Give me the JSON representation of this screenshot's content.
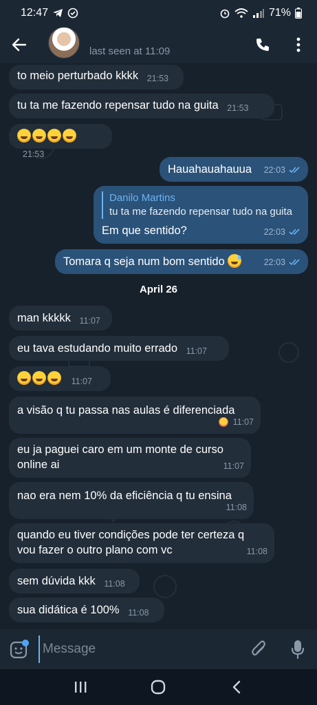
{
  "status_bar": {
    "time": "12:47",
    "battery": "71%"
  },
  "header": {
    "last_seen": "last seen at 11:09"
  },
  "messages": [
    {
      "dir": "in",
      "text": "to meio perturbado kkkk",
      "time": "21:53"
    },
    {
      "dir": "in",
      "text": "tu ta me fazendo repensar tudo na guita",
      "time": "21:53"
    },
    {
      "dir": "in",
      "text": "",
      "time": "21:53"
    },
    {
      "dir": "out",
      "text": "Hauahauahauua",
      "time": "22:03"
    },
    {
      "dir": "out",
      "quote_name": "Danilo Martins",
      "quote_text": "tu ta me fazendo repensar tudo na guita",
      "text": "Em que sentido?",
      "time": "22:03"
    },
    {
      "dir": "out",
      "text": "Tomara q seja num bom sentido",
      "time": "22:03"
    },
    {
      "dir": "date",
      "text": "April 26"
    },
    {
      "dir": "in",
      "text": "man kkkkk",
      "time": "11:07"
    },
    {
      "dir": "in",
      "text": "eu tava estudando muito errado",
      "time": "11:07"
    },
    {
      "dir": "in",
      "text": "",
      "time": "11:07"
    },
    {
      "dir": "in",
      "text": "a visão q tu passa nas aulas é diferenciada",
      "time": "11:07"
    },
    {
      "dir": "in",
      "text_line1": "eu ja paguei caro em um monte de curso",
      "text_line2": "online ai",
      "time": "11:07"
    },
    {
      "dir": "in",
      "text": "nao era nem 10% da eficiência q tu ensina",
      "time": "11:08"
    },
    {
      "dir": "in",
      "text_line1": "quando eu tiver condições pode ter certeza q",
      "text_line2": "vou fazer o outro plano com vc",
      "time": "11:08"
    },
    {
      "dir": "in",
      "text": "sem dúvida kkk",
      "time": "11:08"
    },
    {
      "dir": "in",
      "text": "sua didática é 100%",
      "time": "11:08"
    }
  ],
  "input": {
    "placeholder": "Message"
  },
  "colors": {
    "chat_bg": "#17212b",
    "incoming_bubble": "#222e3a",
    "outgoing_bubble": "#2b5278",
    "accent": "#6ab3f3"
  },
  "icons": {
    "back": "arrow-left-icon",
    "call": "phone-icon",
    "menu": "more-vertical-icon",
    "sticker": "sticker-icon",
    "attach": "paperclip-icon",
    "mic": "microphone-icon"
  }
}
